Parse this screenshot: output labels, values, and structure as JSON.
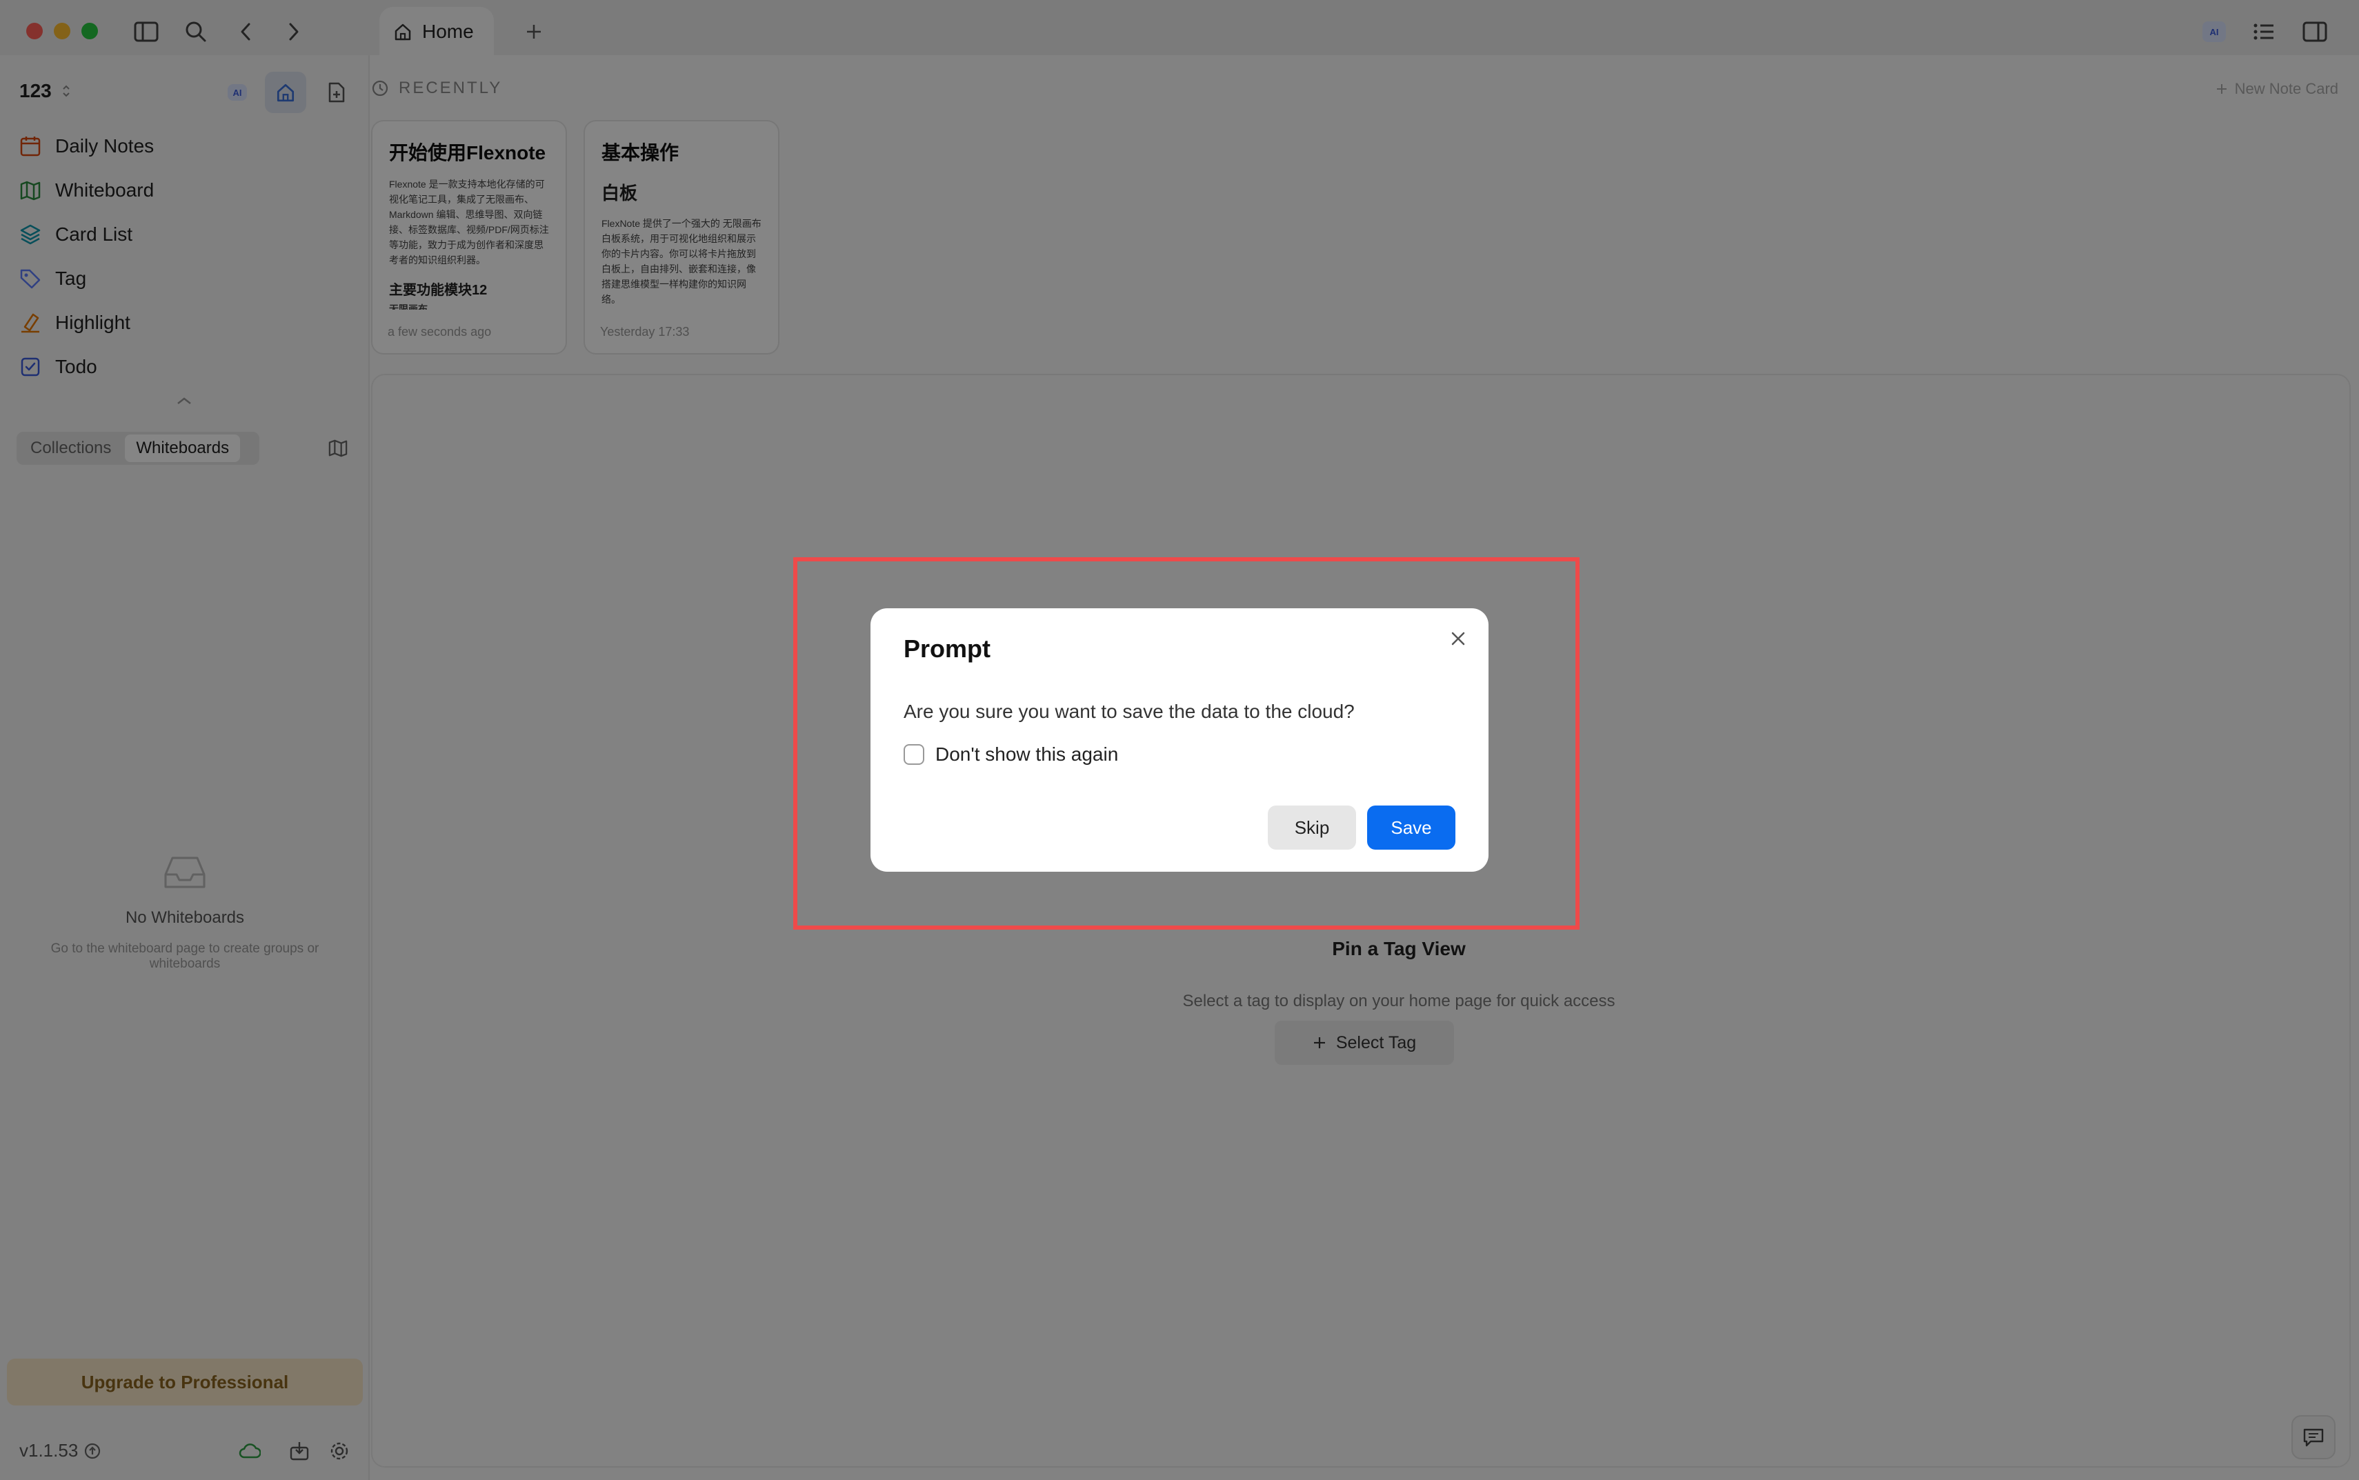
{
  "tabs": [
    {
      "label": "Home"
    }
  ],
  "sidebar": {
    "workspace": "123",
    "nav": [
      {
        "label": "Daily Notes",
        "icon": "calendar-icon"
      },
      {
        "label": "Whiteboard",
        "icon": "map-icon"
      },
      {
        "label": "Card List",
        "icon": "layers-icon"
      },
      {
        "label": "Tag",
        "icon": "tag-icon"
      },
      {
        "label": "Highlight",
        "icon": "highlighter-icon"
      },
      {
        "label": "Todo",
        "icon": "checkbox-icon"
      }
    ],
    "segments": [
      "Collections",
      "Whiteboards"
    ],
    "active_segment": "Whiteboards",
    "empty": {
      "title": "No Whiteboards",
      "desc": "Go to the whiteboard page to create groups or whiteboards"
    },
    "upgrade": "Upgrade to Professional",
    "version": "v1.1.53",
    "ai_badge": "AI"
  },
  "main": {
    "recent_label": "RECENTLY",
    "new_note_card": "New Note Card",
    "cards": [
      {
        "title": "开始使用Flexnote",
        "body": "Flexnote 是一款支持本地化存储的可视化笔记工具，集成了无限画布、Markdown 编辑、思维导图、双向链接、标签数据库、视频/PDF/网页标注等功能，致力于成为创作者和深度思考者的知识组织利器。",
        "h2": "主要功能模块12",
        "extra": "无限画布",
        "time": "a few seconds ago"
      },
      {
        "title": "基本操作",
        "sub": "白板",
        "body": "FlexNote 提供了一个强大的 无限画布白板系统，用于可视化地组织和展示你的卡片内容。你可以将卡片拖放到白板上，自由排列、嵌套和连接，像搭建思维模型一样构建你的知识网络。",
        "time": "Yesterday 17:33"
      }
    ],
    "pin": {
      "title": "Pin a Tag View",
      "desc": "Select a tag to display on your home page for quick access",
      "button": "Select Tag"
    }
  },
  "dialog": {
    "title": "Prompt",
    "message": "Are you sure you want to save the data to the cloud?",
    "checkbox_label": "Don't show this again",
    "checkbox_checked": false,
    "skip": "Skip",
    "save": "Save"
  },
  "colors": {
    "accent": "#0a6cf0",
    "highlight_border": "#ef4a4a",
    "upgrade_bg": "#f8e6c8",
    "cloud_icon": "#2f9e44"
  }
}
